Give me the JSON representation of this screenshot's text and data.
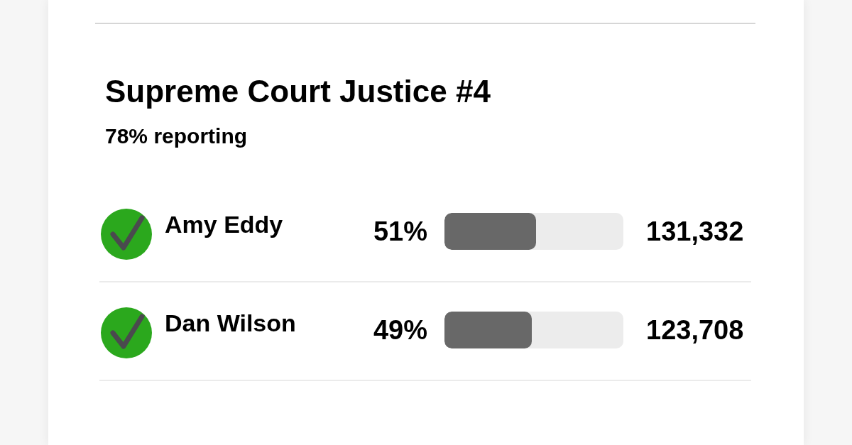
{
  "race": {
    "title": "Supreme Court Justice #4",
    "reporting": "78% reporting"
  },
  "candidates": [
    {
      "name": "Amy Eddy",
      "winner": true,
      "percent": "51%",
      "level": 0.51,
      "votes": "131,332"
    },
    {
      "name": "Dan Wilson",
      "winner": true,
      "percent": "49%",
      "level": 0.49,
      "votes": "123,708"
    }
  ]
}
